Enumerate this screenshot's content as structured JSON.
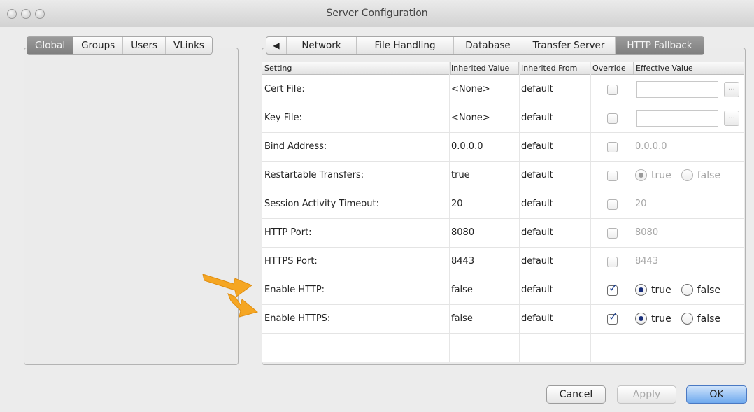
{
  "window": {
    "title": "Server Configuration"
  },
  "left_tabs": [
    {
      "label": "Global",
      "selected": true
    },
    {
      "label": "Groups",
      "selected": false
    },
    {
      "label": "Users",
      "selected": false
    },
    {
      "label": "VLinks",
      "selected": false
    }
  ],
  "right_tabs": {
    "scroll_arrow": "◀",
    "items": [
      {
        "label": "Network",
        "selected": false
      },
      {
        "label": "File Handling",
        "selected": false
      },
      {
        "label": "Database",
        "selected": false
      },
      {
        "label": "Transfer Server",
        "selected": false
      },
      {
        "label": "HTTP Fallback",
        "selected": true
      }
    ]
  },
  "table": {
    "headers": {
      "setting": "Setting",
      "inherited_value": "Inherited Value",
      "inherited_from": "Inherited From",
      "override": "Override",
      "effective_value": "Effective Value"
    },
    "rows": [
      {
        "setting": "Cert File:",
        "inherited_value": "<None>",
        "inherited_from": "default",
        "override": false,
        "effective": {
          "kind": "file",
          "value": "",
          "browse": "..."
        }
      },
      {
        "setting": "Key File:",
        "inherited_value": "<None>",
        "inherited_from": "default",
        "override": false,
        "effective": {
          "kind": "file",
          "value": "",
          "browse": "..."
        }
      },
      {
        "setting": "Bind Address:",
        "inherited_value": "0.0.0.0",
        "inherited_from": "default",
        "override": false,
        "effective": {
          "kind": "text",
          "value": "0.0.0.0"
        }
      },
      {
        "setting": "Restartable Transfers:",
        "inherited_value": "true",
        "inherited_from": "default",
        "override": false,
        "effective": {
          "kind": "radio",
          "true_label": "true",
          "false_label": "false",
          "selected": "true"
        }
      },
      {
        "setting": "Session Activity Timeout:",
        "inherited_value": "20",
        "inherited_from": "default",
        "override": false,
        "effective": {
          "kind": "text",
          "value": "20"
        }
      },
      {
        "setting": "HTTP Port:",
        "inherited_value": "8080",
        "inherited_from": "default",
        "override": false,
        "effective": {
          "kind": "text",
          "value": "8080"
        }
      },
      {
        "setting": "HTTPS Port:",
        "inherited_value": "8443",
        "inherited_from": "default",
        "override": false,
        "effective": {
          "kind": "text",
          "value": "8443"
        }
      },
      {
        "setting": "Enable HTTP:",
        "inherited_value": "false",
        "inherited_from": "default",
        "override": true,
        "effective": {
          "kind": "radio",
          "true_label": "true",
          "false_label": "false",
          "selected": "true"
        }
      },
      {
        "setting": "Enable HTTPS:",
        "inherited_value": "false",
        "inherited_from": "default",
        "override": true,
        "effective": {
          "kind": "radio",
          "true_label": "true",
          "false_label": "false",
          "selected": "true"
        }
      }
    ]
  },
  "buttons": {
    "cancel": "Cancel",
    "apply": "Apply",
    "ok": "OK"
  },
  "colors": {
    "annotation_arrow": "#f5a623",
    "selected_tab": "#8a8a8a",
    "default_button": "#6ea9ee"
  }
}
